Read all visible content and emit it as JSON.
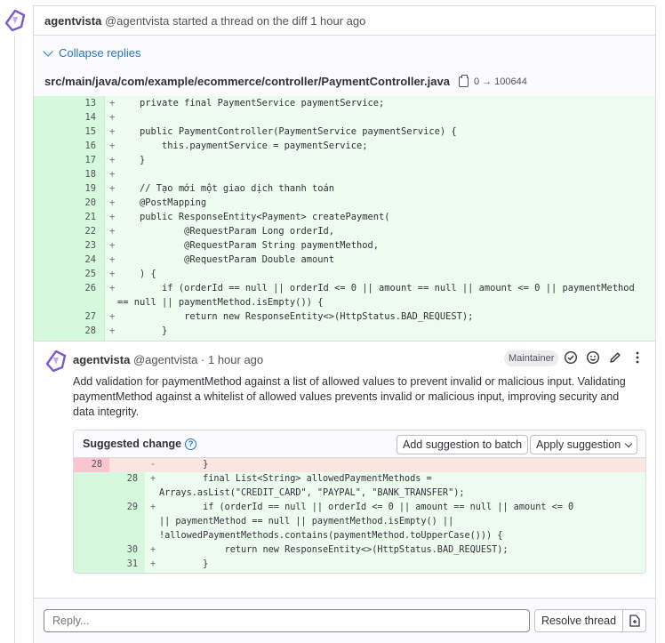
{
  "thread": {
    "author_name": "agentvista",
    "author_handle": "@agentvista",
    "action_text": "started a thread on the diff",
    "time": "1 hour ago",
    "collapse_label": "Collapse replies"
  },
  "file": {
    "path": "src/main/java/com/example/ecommerce/controller/PaymentController.java",
    "mode_change": "0 → 100644"
  },
  "diff_lines": [
    {
      "num": "13",
      "code": "    private final PaymentService paymentService;"
    },
    {
      "num": "14",
      "code": ""
    },
    {
      "num": "15",
      "code": "    public PaymentController(PaymentService paymentService) {"
    },
    {
      "num": "16",
      "code": "        this.paymentService = paymentService;"
    },
    {
      "num": "17",
      "code": "    }"
    },
    {
      "num": "18",
      "code": ""
    },
    {
      "num": "19",
      "code": "    // Tạo mới một giao dịch thanh toán"
    },
    {
      "num": "20",
      "code": "    @PostMapping"
    },
    {
      "num": "21",
      "code": "    public ResponseEntity<Payment> createPayment("
    },
    {
      "num": "22",
      "code": "            @RequestParam Long orderId,"
    },
    {
      "num": "23",
      "code": "            @RequestParam String paymentMethod,"
    },
    {
      "num": "24",
      "code": "            @RequestParam Double amount"
    },
    {
      "num": "25",
      "code": "    ) {"
    },
    {
      "num": "26",
      "code": "        if (orderId == null || orderId <= 0 || amount == null || amount <= 0 || paymentMethod == null || paymentMethod.isEmpty()) {"
    },
    {
      "num": "27",
      "code": "            return new ResponseEntity<>(HttpStatus.BAD_REQUEST);"
    },
    {
      "num": "28",
      "code": "        }"
    }
  ],
  "comment": {
    "author_name": "agentvista",
    "author_handle": "@agentvista",
    "time": "· 1 hour ago",
    "role_badge": "Maintainer",
    "body": "Add validation for paymentMethod against a list of allowed values to prevent invalid or malicious input. Validating paymentMethod against a whitelist of allowed values prevents invalid or malicious input, improving security and data integrity."
  },
  "suggestion": {
    "title": "Suggested change",
    "add_batch_label": "Add suggestion to batch",
    "apply_label": "Apply suggestion",
    "lines": [
      {
        "old": "28",
        "new": "",
        "sign": "-",
        "code": "        }"
      },
      {
        "old": "",
        "new": "28",
        "sign": "+",
        "code": "        final List<String> allowedPaymentMethods = Arrays.asList(\"CREDIT_CARD\", \"PAYPAL\", \"BANK_TRANSFER\");"
      },
      {
        "old": "",
        "new": "29",
        "sign": "+",
        "code": "        if (orderId == null || orderId <= 0 || amount == null || amount <= 0 || paymentMethod == null || paymentMethod.isEmpty() || !allowedPaymentMethods.contains(paymentMethod.toUpperCase())) {"
      },
      {
        "old": "",
        "new": "30",
        "sign": "+",
        "code": "            return new ResponseEntity<>(HttpStatus.BAD_REQUEST);"
      },
      {
        "old": "",
        "new": "31",
        "sign": "+",
        "code": "        }"
      }
    ]
  },
  "reply": {
    "placeholder": "Reply...",
    "resolve_label": "Resolve thread"
  },
  "colors": {
    "link": "#1f75cb",
    "added_bg": "#ecfdf0",
    "added_gutter": "#d6f8dd",
    "removed_bg": "#fbe5e1",
    "avatar": "#7b58cf"
  }
}
